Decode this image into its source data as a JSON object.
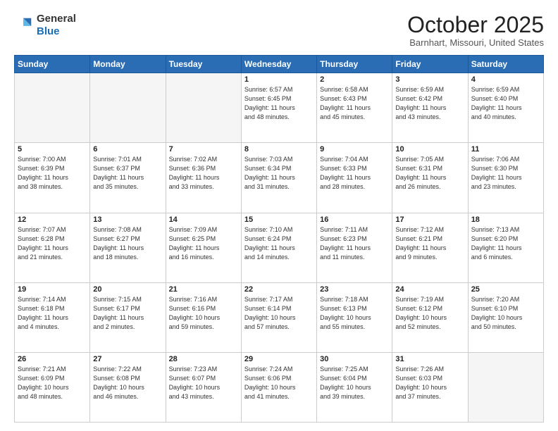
{
  "logo": {
    "general": "General",
    "blue": "Blue"
  },
  "header": {
    "month": "October 2025",
    "location": "Barnhart, Missouri, United States"
  },
  "days_of_week": [
    "Sunday",
    "Monday",
    "Tuesday",
    "Wednesday",
    "Thursday",
    "Friday",
    "Saturday"
  ],
  "weeks": [
    [
      {
        "day": "",
        "info": ""
      },
      {
        "day": "",
        "info": ""
      },
      {
        "day": "",
        "info": ""
      },
      {
        "day": "1",
        "info": "Sunrise: 6:57 AM\nSunset: 6:45 PM\nDaylight: 11 hours\nand 48 minutes."
      },
      {
        "day": "2",
        "info": "Sunrise: 6:58 AM\nSunset: 6:43 PM\nDaylight: 11 hours\nand 45 minutes."
      },
      {
        "day": "3",
        "info": "Sunrise: 6:59 AM\nSunset: 6:42 PM\nDaylight: 11 hours\nand 43 minutes."
      },
      {
        "day": "4",
        "info": "Sunrise: 6:59 AM\nSunset: 6:40 PM\nDaylight: 11 hours\nand 40 minutes."
      }
    ],
    [
      {
        "day": "5",
        "info": "Sunrise: 7:00 AM\nSunset: 6:39 PM\nDaylight: 11 hours\nand 38 minutes."
      },
      {
        "day": "6",
        "info": "Sunrise: 7:01 AM\nSunset: 6:37 PM\nDaylight: 11 hours\nand 35 minutes."
      },
      {
        "day": "7",
        "info": "Sunrise: 7:02 AM\nSunset: 6:36 PM\nDaylight: 11 hours\nand 33 minutes."
      },
      {
        "day": "8",
        "info": "Sunrise: 7:03 AM\nSunset: 6:34 PM\nDaylight: 11 hours\nand 31 minutes."
      },
      {
        "day": "9",
        "info": "Sunrise: 7:04 AM\nSunset: 6:33 PM\nDaylight: 11 hours\nand 28 minutes."
      },
      {
        "day": "10",
        "info": "Sunrise: 7:05 AM\nSunset: 6:31 PM\nDaylight: 11 hours\nand 26 minutes."
      },
      {
        "day": "11",
        "info": "Sunrise: 7:06 AM\nSunset: 6:30 PM\nDaylight: 11 hours\nand 23 minutes."
      }
    ],
    [
      {
        "day": "12",
        "info": "Sunrise: 7:07 AM\nSunset: 6:28 PM\nDaylight: 11 hours\nand 21 minutes."
      },
      {
        "day": "13",
        "info": "Sunrise: 7:08 AM\nSunset: 6:27 PM\nDaylight: 11 hours\nand 18 minutes."
      },
      {
        "day": "14",
        "info": "Sunrise: 7:09 AM\nSunset: 6:25 PM\nDaylight: 11 hours\nand 16 minutes."
      },
      {
        "day": "15",
        "info": "Sunrise: 7:10 AM\nSunset: 6:24 PM\nDaylight: 11 hours\nand 14 minutes."
      },
      {
        "day": "16",
        "info": "Sunrise: 7:11 AM\nSunset: 6:23 PM\nDaylight: 11 hours\nand 11 minutes."
      },
      {
        "day": "17",
        "info": "Sunrise: 7:12 AM\nSunset: 6:21 PM\nDaylight: 11 hours\nand 9 minutes."
      },
      {
        "day": "18",
        "info": "Sunrise: 7:13 AM\nSunset: 6:20 PM\nDaylight: 11 hours\nand 6 minutes."
      }
    ],
    [
      {
        "day": "19",
        "info": "Sunrise: 7:14 AM\nSunset: 6:18 PM\nDaylight: 11 hours\nand 4 minutes."
      },
      {
        "day": "20",
        "info": "Sunrise: 7:15 AM\nSunset: 6:17 PM\nDaylight: 11 hours\nand 2 minutes."
      },
      {
        "day": "21",
        "info": "Sunrise: 7:16 AM\nSunset: 6:16 PM\nDaylight: 10 hours\nand 59 minutes."
      },
      {
        "day": "22",
        "info": "Sunrise: 7:17 AM\nSunset: 6:14 PM\nDaylight: 10 hours\nand 57 minutes."
      },
      {
        "day": "23",
        "info": "Sunrise: 7:18 AM\nSunset: 6:13 PM\nDaylight: 10 hours\nand 55 minutes."
      },
      {
        "day": "24",
        "info": "Sunrise: 7:19 AM\nSunset: 6:12 PM\nDaylight: 10 hours\nand 52 minutes."
      },
      {
        "day": "25",
        "info": "Sunrise: 7:20 AM\nSunset: 6:10 PM\nDaylight: 10 hours\nand 50 minutes."
      }
    ],
    [
      {
        "day": "26",
        "info": "Sunrise: 7:21 AM\nSunset: 6:09 PM\nDaylight: 10 hours\nand 48 minutes."
      },
      {
        "day": "27",
        "info": "Sunrise: 7:22 AM\nSunset: 6:08 PM\nDaylight: 10 hours\nand 46 minutes."
      },
      {
        "day": "28",
        "info": "Sunrise: 7:23 AM\nSunset: 6:07 PM\nDaylight: 10 hours\nand 43 minutes."
      },
      {
        "day": "29",
        "info": "Sunrise: 7:24 AM\nSunset: 6:06 PM\nDaylight: 10 hours\nand 41 minutes."
      },
      {
        "day": "30",
        "info": "Sunrise: 7:25 AM\nSunset: 6:04 PM\nDaylight: 10 hours\nand 39 minutes."
      },
      {
        "day": "31",
        "info": "Sunrise: 7:26 AM\nSunset: 6:03 PM\nDaylight: 10 hours\nand 37 minutes."
      },
      {
        "day": "",
        "info": ""
      }
    ]
  ]
}
